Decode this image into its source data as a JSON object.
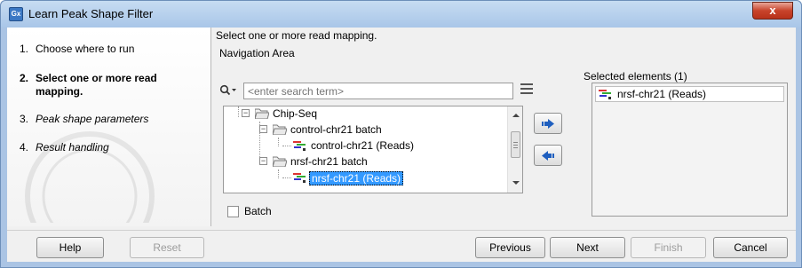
{
  "window": {
    "title": "Learn Peak Shape Filter",
    "app_badge": "Gx",
    "close_glyph": "x"
  },
  "steps": [
    {
      "num": "1.",
      "label": "Choose where to run",
      "state": "done"
    },
    {
      "num": "2.",
      "label": "Select one or more read mapping.",
      "state": "active"
    },
    {
      "num": "3.",
      "label": "Peak shape parameters",
      "state": "future"
    },
    {
      "num": "4.",
      "label": "Result handling",
      "state": "future"
    }
  ],
  "main": {
    "instruction": "Select one or more read mapping.",
    "navigation_label": "Navigation Area",
    "search": {
      "placeholder": "<enter search term>",
      "value": ""
    },
    "tree": [
      {
        "label": "Chip-Seq",
        "type": "folder",
        "expanded": true
      },
      {
        "label": "control-chr21 batch",
        "type": "folder",
        "expanded": true
      },
      {
        "label": "control-chr21 (Reads)",
        "type": "reads"
      },
      {
        "label": "nrsf-chr21 batch",
        "type": "folder",
        "expanded": true
      },
      {
        "label": "nrsf-chr21 (Reads)",
        "type": "reads",
        "selected": true
      }
    ],
    "selected_label": "Selected elements (1)",
    "selected_items": [
      {
        "label": "nrsf-chr21 (Reads)"
      }
    ],
    "batch_label": "Batch",
    "batch_checked": false
  },
  "buttons": {
    "help": "Help",
    "reset": "Reset",
    "previous": "Previous",
    "next": "Next",
    "finish": "Finish",
    "cancel": "Cancel"
  },
  "colors": {
    "selection": "#3399ff",
    "title_bar": "#aac4e4",
    "arrow_blue": "#1f5fbf"
  }
}
